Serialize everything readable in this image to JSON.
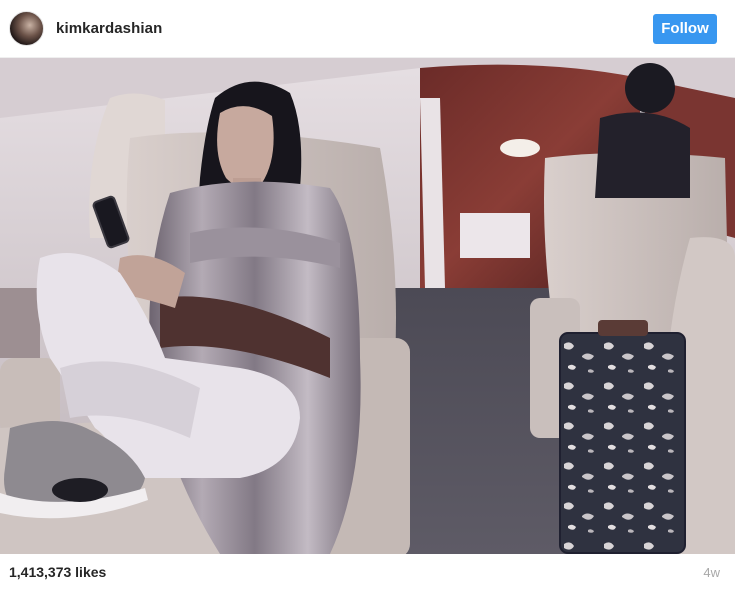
{
  "post": {
    "username": "kimkardashian",
    "follow_label": "Follow",
    "likes": "1,413,373 likes",
    "age": "4w"
  },
  "icons": {
    "avatar": "profile-avatar"
  },
  "colors": {
    "follow_button": "#3897f0",
    "username": "#262626",
    "timestamp": "#a8a8a8"
  }
}
